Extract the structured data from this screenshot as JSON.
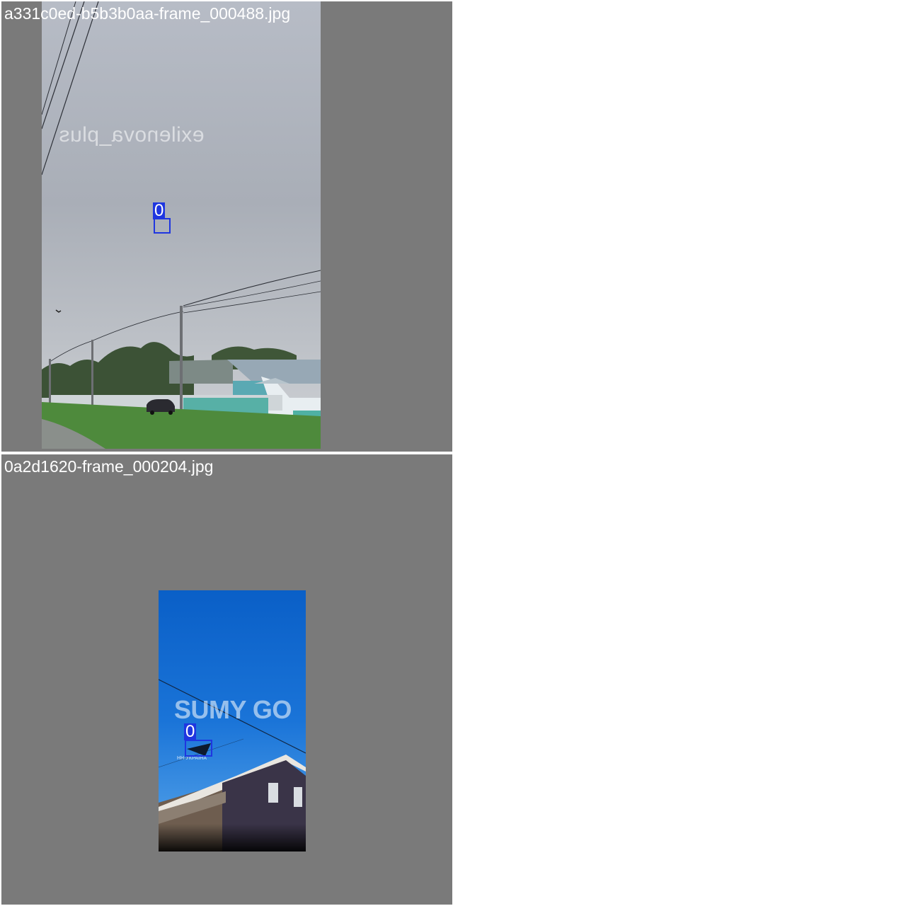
{
  "images": [
    {
      "filename": "a331c0ed-b5b3b0aa-frame_000488.jpg",
      "watermark": "exilenova_plus",
      "detections": [
        {
          "class_label": "0"
        }
      ]
    },
    {
      "filename": "0a2d1620-frame_000204.jpg",
      "watermark": "SUMY GO",
      "sub_watermark": "НН-УКРАЇНА",
      "detections": [
        {
          "class_label": "0"
        }
      ]
    }
  ],
  "colors": {
    "tile_background": "#7a7a7a",
    "box_color": "#1f36e0",
    "filename_text": "#ffffff",
    "page_background": "#ffffff"
  }
}
